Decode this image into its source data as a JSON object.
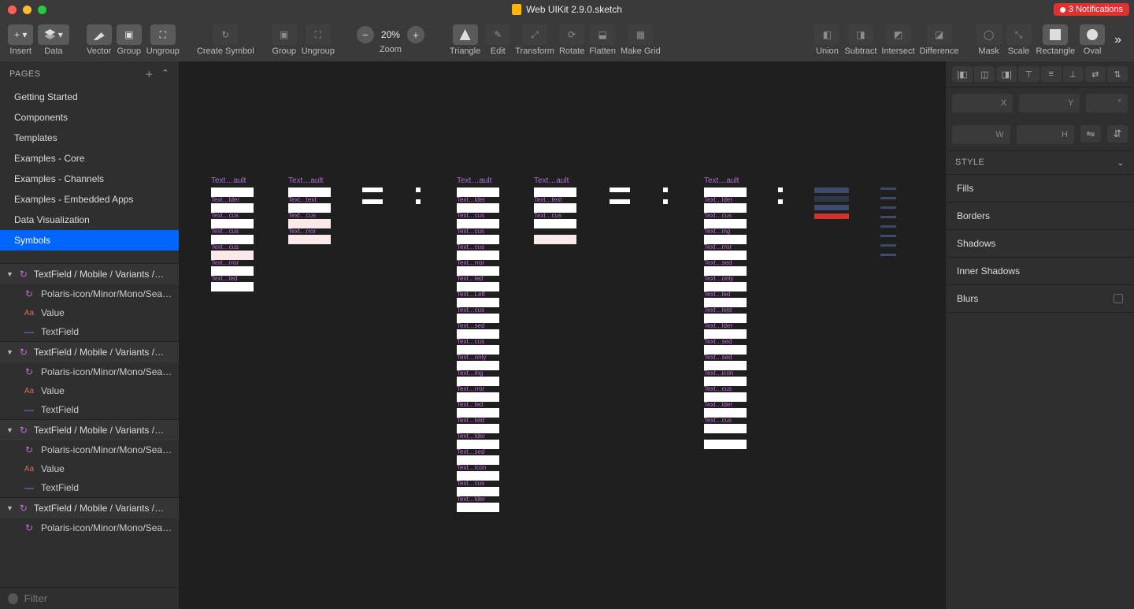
{
  "window": {
    "title": "Web UIKit 2.9.0.sketch",
    "notifications": "3 Notifications"
  },
  "toolbar": {
    "insert": "Insert",
    "data": "Data",
    "vector": "Vector",
    "group": "Group",
    "ungroup": "Ungroup",
    "create_symbol": "Create Symbol",
    "group2": "Group",
    "ungroup2": "Ungroup",
    "zoom": "Zoom",
    "zoom_val": "20%",
    "triangle": "Triangle",
    "edit": "Edit",
    "transform": "Transform",
    "rotate": "Rotate",
    "flatten": "Flatten",
    "make_grid": "Make Grid",
    "union": "Union",
    "subtract": "Subtract",
    "intersect": "Intersect",
    "difference": "Difference",
    "mask": "Mask",
    "scale": "Scale",
    "rectangle": "Rectangle",
    "oval": "Oval"
  },
  "pages": {
    "header": "PAGES",
    "items": [
      "Getting Started",
      "Components",
      "Templates",
      "Examples - Core",
      "Examples - Channels",
      "Examples - Embedded Apps",
      "Data Visualization",
      "Symbols"
    ],
    "active_index": 7
  },
  "layers": {
    "folder_label": "TextField / Mobile / Variants /…",
    "child1": "Polaris-icon/Minor/Mono/Sea…",
    "child2": "Value",
    "child3": "TextField"
  },
  "filter": {
    "placeholder": "Filter"
  },
  "inspector": {
    "x": "X",
    "y": "Y",
    "deg": "°",
    "w": "W",
    "h": "H",
    "style_header": "STYLE",
    "fills": "Fills",
    "borders": "Borders",
    "shadows": "Shadows",
    "inner_shadows": "Inner Shadows",
    "blurs": "Blurs"
  },
  "canvas": {
    "col_label": "Text…ault",
    "variants": [
      "Text…lder",
      "Text…cus",
      "Text…cus",
      "Text…cus",
      "Text…rror",
      "Text…led",
      "Text…Left",
      "Text…cus",
      "Text…sed",
      "Text…cus",
      "Text…only",
      "Text…ing",
      "Text…rror",
      "Text…led",
      "Text…leld",
      "Text…lder",
      "Text…sed",
      "Text…icon",
      "Text…cus",
      "Text…lder",
      "Text…text"
    ]
  }
}
